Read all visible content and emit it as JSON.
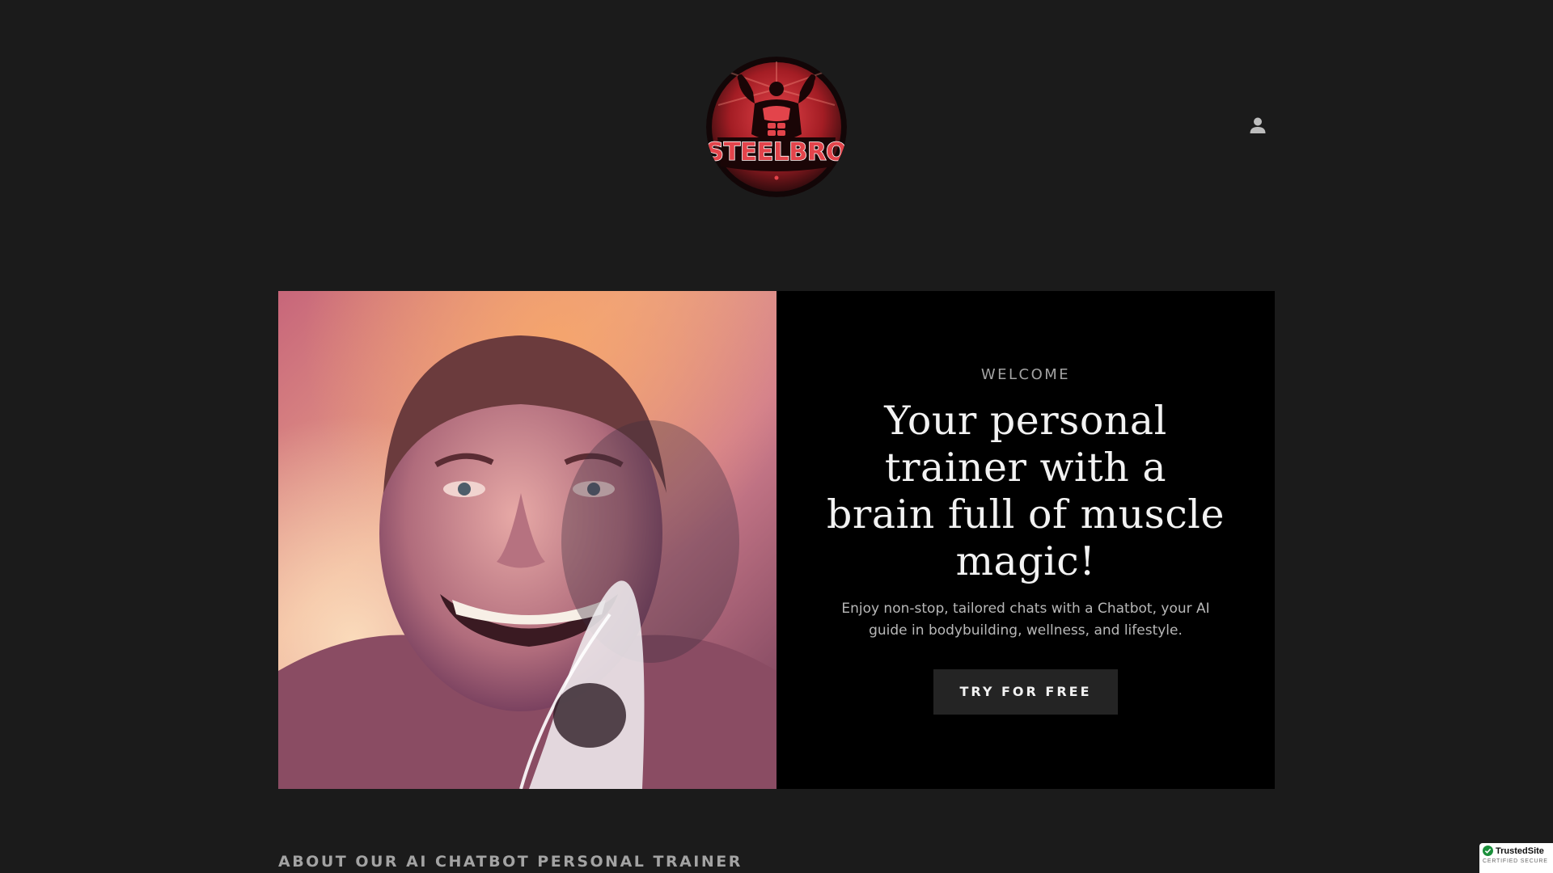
{
  "header": {
    "logo_text": "STEELBRO",
    "account_icon": "user-icon"
  },
  "hero": {
    "image_alt": "smiling bodybuilder portrait",
    "eyebrow": "WELCOME",
    "headline": "Your personal trainer with a brain full of muscle magic!",
    "subtext": "Enjoy non-stop, tailored chats with a Chatbot, your AI guide in bodybuilding, wellness, and lifestyle.",
    "cta_label": "TRY FOR FREE"
  },
  "about": {
    "heading": "ABOUT OUR AI CHATBOT PERSONAL TRAINER"
  },
  "trust_badge": {
    "name": "TrustedSite",
    "subtitle": "CERTIFIED SECURE"
  },
  "colors": {
    "page_background": "#1b1b1b",
    "panel_background": "#000000",
    "button_background": "#242424",
    "logo_red": "#d8323a"
  }
}
